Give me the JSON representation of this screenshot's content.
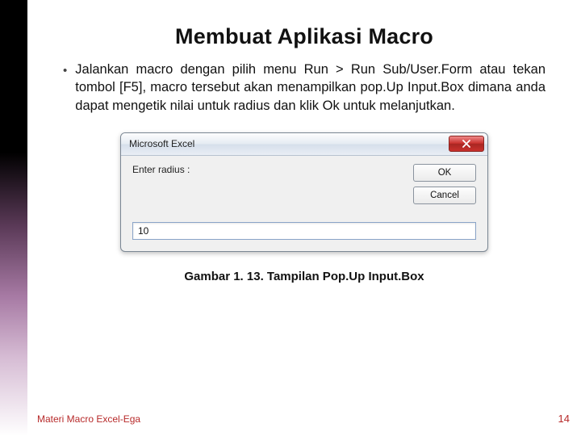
{
  "title": "Membuat Aplikasi Macro",
  "bullet": "Jalankan macro dengan pilih menu Run > Run Sub/User.Form atau tekan tombol [F5], macro tersebut akan menampilkan pop.Up Input.Box dimana anda dapat mengetik nilai untuk radius dan klik Ok untuk melanjutkan.",
  "dialog": {
    "title": "Microsoft Excel",
    "prompt": "Enter radius :",
    "ok": "OK",
    "cancel": "Cancel",
    "value": "10"
  },
  "caption": "Gambar 1. 13. Tampilan Pop.Up Input.Box",
  "footer_left": "Materi Macro Excel-Ega",
  "footer_right": "14"
}
